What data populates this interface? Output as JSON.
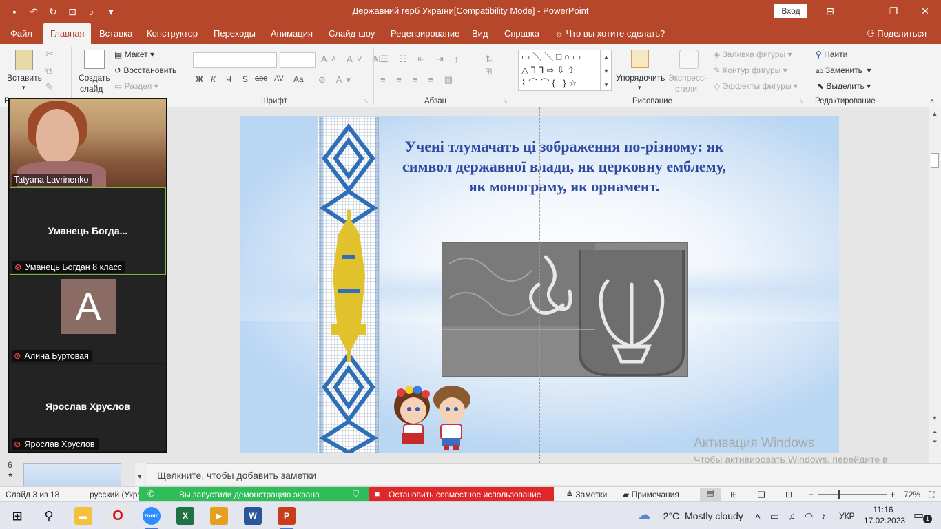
{
  "window": {
    "title": "Державний герб України[Compatibility Mode]  -  PowerPoint",
    "sign_in": "Вход",
    "qat_icons": [
      "save-icon",
      "undo-icon",
      "redo-icon",
      "present-icon",
      "speaker-icon",
      "customize-icon"
    ]
  },
  "tabs": [
    {
      "label": "Файл",
      "active": false
    },
    {
      "label": "Главная",
      "active": true
    },
    {
      "label": "Вставка",
      "active": false
    },
    {
      "label": "Конструктор",
      "active": false
    },
    {
      "label": "Переходы",
      "active": false
    },
    {
      "label": "Анимация",
      "active": false
    },
    {
      "label": "Слайд-шоу",
      "active": false
    },
    {
      "label": "Рецензирование",
      "active": false
    },
    {
      "label": "Вид",
      "active": false
    },
    {
      "label": "Справка",
      "active": false
    }
  ],
  "tell_me": "Что вы хотите сделать?",
  "share": "Поделиться",
  "ribbon": {
    "clipboard": {
      "paste": "Вставить",
      "label": "Б"
    },
    "slides": {
      "new_slide_line1": "Создать",
      "new_slide_line2": "слайд",
      "layout": "Макет",
      "reset": "Восстановить",
      "section": "Раздел"
    },
    "font": {
      "label": "Шрифт",
      "bold": "Ж",
      "italic": "К",
      "underline": "Ч",
      "shadow": "S",
      "strike": "abc",
      "spacing": "AV",
      "case": "Aa"
    },
    "paragraph": {
      "label": "Абзац"
    },
    "drawing": {
      "label": "Рисование",
      "arrange_line1": "Упорядочить",
      "quick_styles_line1": "Экспресс-",
      "quick_styles_line2": "стили",
      "fill": "Заливка фигуры",
      "outline": "Контур фигуры",
      "effects": "Эффекты фигуры"
    },
    "editing": {
      "label": "Редактирование",
      "find": "Найти",
      "replace": "Заменить",
      "select": "Выделить"
    }
  },
  "slide": {
    "title": "Учені  тлумачать ці зображення по-різному: як символ державної влади, як церковну емблему, як монограму, як орнамент."
  },
  "watermark": {
    "title": "Активация Windows",
    "body": "Чтобы активировать Windows, перейдите в раздел \"Параметры\"."
  },
  "thumbnails": {
    "visible_number": "6",
    "star": "★"
  },
  "participants": [
    {
      "name": "Tatyana Lavrinenko",
      "video": true,
      "muted": false
    },
    {
      "name": "Уманець  Богда...",
      "label": "Уманець Богдан 8 класс",
      "video": false,
      "muted": true,
      "speaking": true
    },
    {
      "name": "Алина Буртовая",
      "avatar_letter": "A",
      "video": false,
      "muted": true
    },
    {
      "name": "Ярослав Хруслов",
      "label": "Ярослав Хруслов",
      "video": false,
      "muted": true
    }
  ],
  "notes_placeholder": "Щелкните, чтобы добавить заметки",
  "status": {
    "slide_counter": "Слайд 3 из 18",
    "language": "русский (Укра",
    "sharing_message": "Вы запустили демонстрацию экрана",
    "stop_sharing": "Остановить совместное использование",
    "notes": "Заметки",
    "comments": "Примечания",
    "zoom": "72%",
    "zoom_minus": "−",
    "zoom_plus": "+"
  },
  "taskbar": {
    "apps": [
      "windows-start-icon",
      "search-icon",
      "file-explorer-icon",
      "opera-icon",
      "zoom-icon",
      "excel-icon",
      "video-player-icon",
      "word-icon",
      "powerpoint-icon"
    ],
    "weather_temp": "-2°C",
    "weather_text": "Mostly cloudy",
    "lang": "УКР",
    "time": "11:16",
    "date": "17.02.2023",
    "notifications": "1"
  },
  "colors": {
    "accent": "#b7472a",
    "slide_title": "#2e4a9e",
    "speaking_border": "#7ab93a",
    "share_green": "#2ebd59",
    "share_red": "#e02828"
  }
}
